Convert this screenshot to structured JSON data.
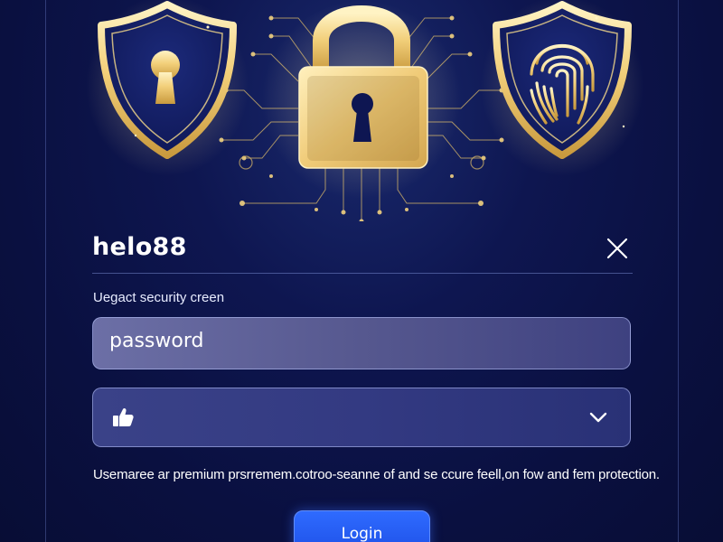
{
  "header": {
    "app_name": "helo88",
    "close_icon": "close-icon"
  },
  "form": {
    "subtitle": "Uegact security creen",
    "password_field": {
      "value": "password"
    },
    "select_field": {
      "icon": "thumbs-up-icon",
      "dropdown_icon": "chevron-down-icon"
    },
    "description": "Usemaree ar premium prsrremem.cotroo-seanne of and se ccure feell,on fow and fem protection.",
    "login_label": "Login"
  },
  "hero": {
    "icons": [
      "keyhole-shield-icon",
      "padlock-icon",
      "fingerprint-shield-icon"
    ]
  },
  "colors": {
    "background": "#0b1140",
    "accent_gold": "#e9c46a",
    "button_blue": "#1f55ee",
    "text": "#ffffff"
  }
}
